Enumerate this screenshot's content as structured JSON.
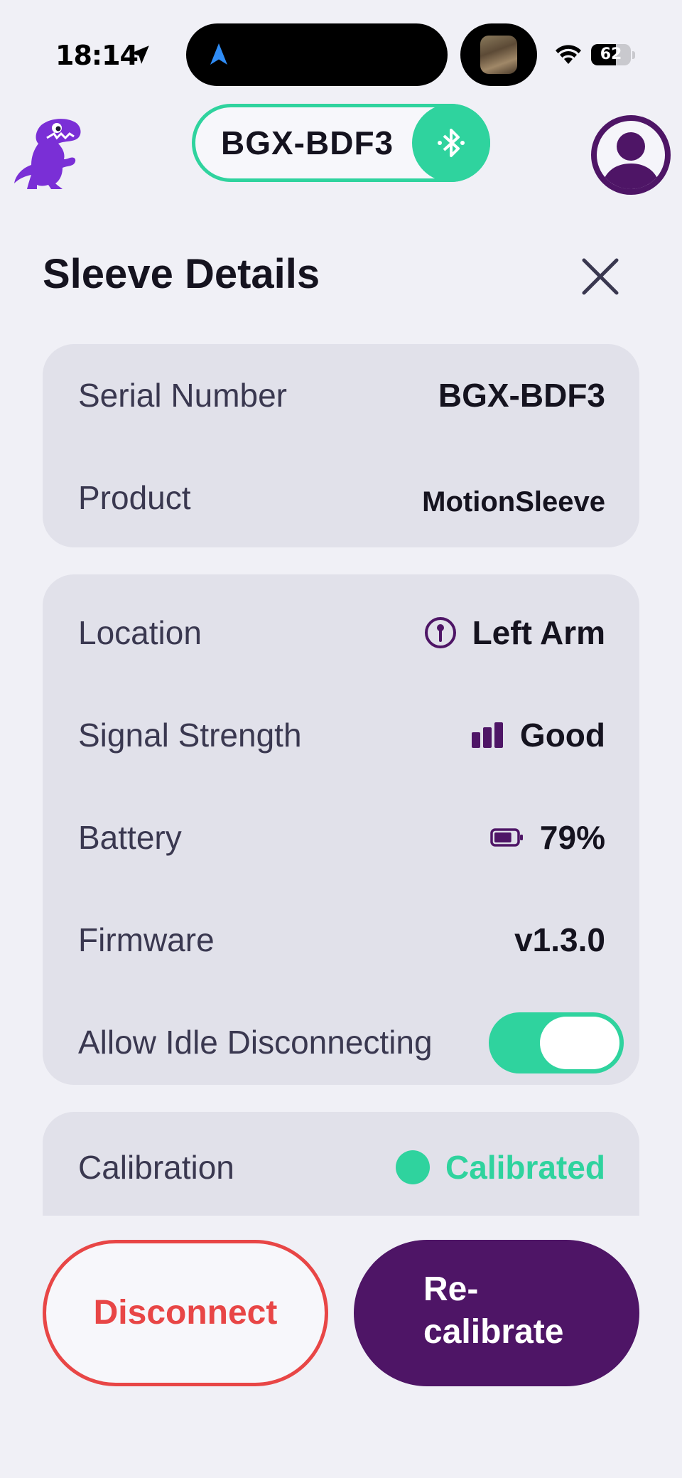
{
  "status_bar": {
    "time": "18:14",
    "battery_level": "62",
    "battery_fraction": 0.62
  },
  "header": {
    "device_name": "BGX-BDF3",
    "bluetooth_icon": "bluetooth-icon",
    "logo_icon": "dinosaur-logo",
    "profile_icon": "user-avatar-icon"
  },
  "page": {
    "title": "Sleeve Details",
    "close_icon": "close-icon"
  },
  "device_info": {
    "serial_label": "Serial Number",
    "serial_value": "BGX-BDF3",
    "product_label": "Product",
    "product_value": "MotionSleeve"
  },
  "status_info": {
    "location_label": "Location",
    "location_value": "Left Arm",
    "signal_label": "Signal Strength",
    "signal_value": "Good",
    "battery_label": "Battery",
    "battery_value": "79%",
    "battery_fraction": 0.79,
    "firmware_label": "Firmware",
    "firmware_value": "v1.3.0",
    "idle_label": "Allow Idle Disconnecting",
    "idle_enabled": true
  },
  "calibration": {
    "label": "Calibration",
    "value": "Calibrated"
  },
  "actions": {
    "disconnect_label": "Disconnect",
    "recalibrate_label": "Re-\ncalibrate"
  },
  "colors": {
    "accent_green": "#2fd39e",
    "brand_purple": "#4e1566",
    "danger_red": "#e84646",
    "background": "#f0f0f6",
    "card": "#e1e1ea"
  }
}
